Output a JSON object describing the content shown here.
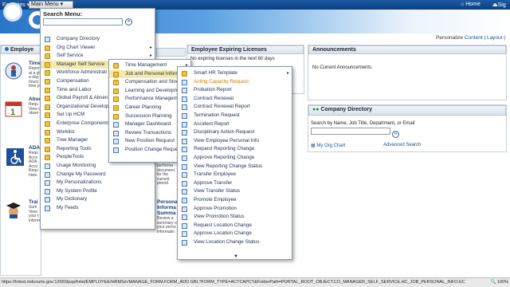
{
  "topbar": {
    "favorites": "Favorites",
    "main_menu": "Main Menu",
    "home": "Home",
    "sign": "Sig"
  },
  "personalize": {
    "label": "Personalize",
    "content": "Content",
    "sep": "|",
    "layout": "Layout",
    "sep2": "|"
  },
  "left_column": {
    "header": "Employe",
    "tiles": [
      {
        "title": "Time",
        "desc": "Repor\nat a gl\na day,\nhours\ntime p"
      },
      {
        "title": "Abse",
        "desc": "Requ\nView c\nobser"
      },
      {
        "title": "ADA",
        "desc": "Requ\nAcco\nADA\nAcco\nRequ\nhisto"
      },
      {
        "title": "Trai",
        "desc": "Sum\nView\nyour t\ninform"
      }
    ]
  },
  "center_pane": {
    "header": "Employee Expiring Licenses",
    "no_licenses": "No expiring licenses in the next 60 days",
    "personal_title": "Persona\nInforma\nSumma",
    "personal_desc": "Review a\nsummary o\nyour perso\ninformatio",
    "perf_desc": "performa\ndocument\nfor the\ncurrent\nperiod."
  },
  "announcements": {
    "header": "Announcements",
    "empty": "No Current Announcements."
  },
  "company_directory": {
    "header": "Company Directory",
    "search_label": "Search by Name, Job Title, Department, or Email",
    "org_chart": "My Org Chart",
    "advanced_search": "Advanced Search"
  },
  "search_menu": {
    "title": "Search Menu:",
    "go": "»",
    "items": [
      {
        "label": "Company Directory",
        "type": "page"
      },
      {
        "label": "Org Chart Viewer",
        "type": "folder",
        "arrow": true
      },
      {
        "label": "Self Service",
        "type": "folder",
        "arrow": true
      },
      {
        "label": "Manager Self Service",
        "type": "folder",
        "arrow": true,
        "highlighted": true
      },
      {
        "label": "Workforce Administrati",
        "type": "folder"
      },
      {
        "label": "Compensation",
        "type": "folder"
      },
      {
        "label": "Time and Labor",
        "type": "folder"
      },
      {
        "label": "Global Payroll & Absen",
        "type": "folder"
      },
      {
        "label": "Organizational Develop",
        "type": "folder"
      },
      {
        "label": "Set Up HCM",
        "type": "folder"
      },
      {
        "label": "Enterprise Components",
        "type": "folder"
      },
      {
        "label": "Worklist",
        "type": "folder",
        "arrow": true
      },
      {
        "label": "Tree Manager",
        "type": "folder",
        "arrow": true
      },
      {
        "label": "Reporting Tools",
        "type": "folder",
        "arrow": true
      },
      {
        "label": "PeopleTools",
        "type": "folder",
        "arrow": true
      },
      {
        "label": "Usage Monitoring",
        "type": "page"
      },
      {
        "label": "Change My Password",
        "type": "page"
      },
      {
        "label": "My Personalizations",
        "type": "page"
      },
      {
        "label": "My System Profile",
        "type": "page"
      },
      {
        "label": "My Dictionary",
        "type": "page"
      },
      {
        "label": "My Feeds",
        "type": "page"
      }
    ]
  },
  "manager_menu": {
    "items": [
      {
        "label": "Time Management",
        "type": "folder",
        "arrow": true
      },
      {
        "label": "Job and Personal Inform",
        "type": "folder",
        "arrow": true,
        "highlighted": true
      },
      {
        "label": "Compensation and Stoc",
        "type": "folder"
      },
      {
        "label": "Learning and Developm",
        "type": "folder"
      },
      {
        "label": "Performance Managem",
        "type": "folder"
      },
      {
        "label": "Career Planning",
        "type": "folder"
      },
      {
        "label": "Succession Planning",
        "type": "folder"
      },
      {
        "label": "Manager Dashboard",
        "type": "page"
      },
      {
        "label": "Review Transactions",
        "type": "page"
      },
      {
        "label": "New Position Request",
        "type": "page"
      },
      {
        "label": "Position Change Reque",
        "type": "page"
      }
    ]
  },
  "job_menu": {
    "items": [
      {
        "label": "Smart HR Template",
        "type": "folder",
        "arrow": true
      },
      {
        "label": "Acting Capacity Request",
        "type": "page",
        "selected": true
      },
      {
        "label": "Probation Report",
        "type": "page"
      },
      {
        "label": "Contract Renewal",
        "type": "page"
      },
      {
        "label": "Contract Renewal Report",
        "type": "page"
      },
      {
        "label": "Termination Request",
        "type": "page"
      },
      {
        "label": "Accident Report",
        "type": "page"
      },
      {
        "label": "Disciplinary Action Request",
        "type": "page"
      },
      {
        "label": "View Employee Personal Info",
        "type": "page"
      },
      {
        "label": "Request Reporting Change",
        "type": "page"
      },
      {
        "label": "Approve Reporting Change",
        "type": "page"
      },
      {
        "label": "View Reporting Change Status",
        "type": "page"
      },
      {
        "label": "Transfer Employee",
        "type": "page"
      },
      {
        "label": "Approve Transfer",
        "type": "page"
      },
      {
        "label": "View Transfer Status",
        "type": "page"
      },
      {
        "label": "Promote Employee",
        "type": "page"
      },
      {
        "label": "Approve Promotion",
        "type": "page"
      },
      {
        "label": "View Promotion Status",
        "type": "page"
      },
      {
        "label": "Request Location Change",
        "type": "page"
      },
      {
        "label": "Approve Location Change",
        "type": "page"
      },
      {
        "label": "View Location Change Status",
        "type": "page"
      }
    ]
  },
  "status_bar": {
    "url": "https://hrtest.mdcourts.gov:12650/psp/hrtst/EMPLOYEE/HRMS/c/MANAGE_FORM.FORM_ADD.GBL?FORM_TYPE=ACTCAPCT&FolderPath=PORTAL_ROOT_OBJECT.CO_MANAGER_SELF_SERVICE.HC_JOB_PERSONAL_INFO.EC",
    "zoom": "100%"
  },
  "colors": {
    "accent": "#0b3f80",
    "highlight": "#f7e9a8",
    "selected_text": "#d07a00"
  }
}
